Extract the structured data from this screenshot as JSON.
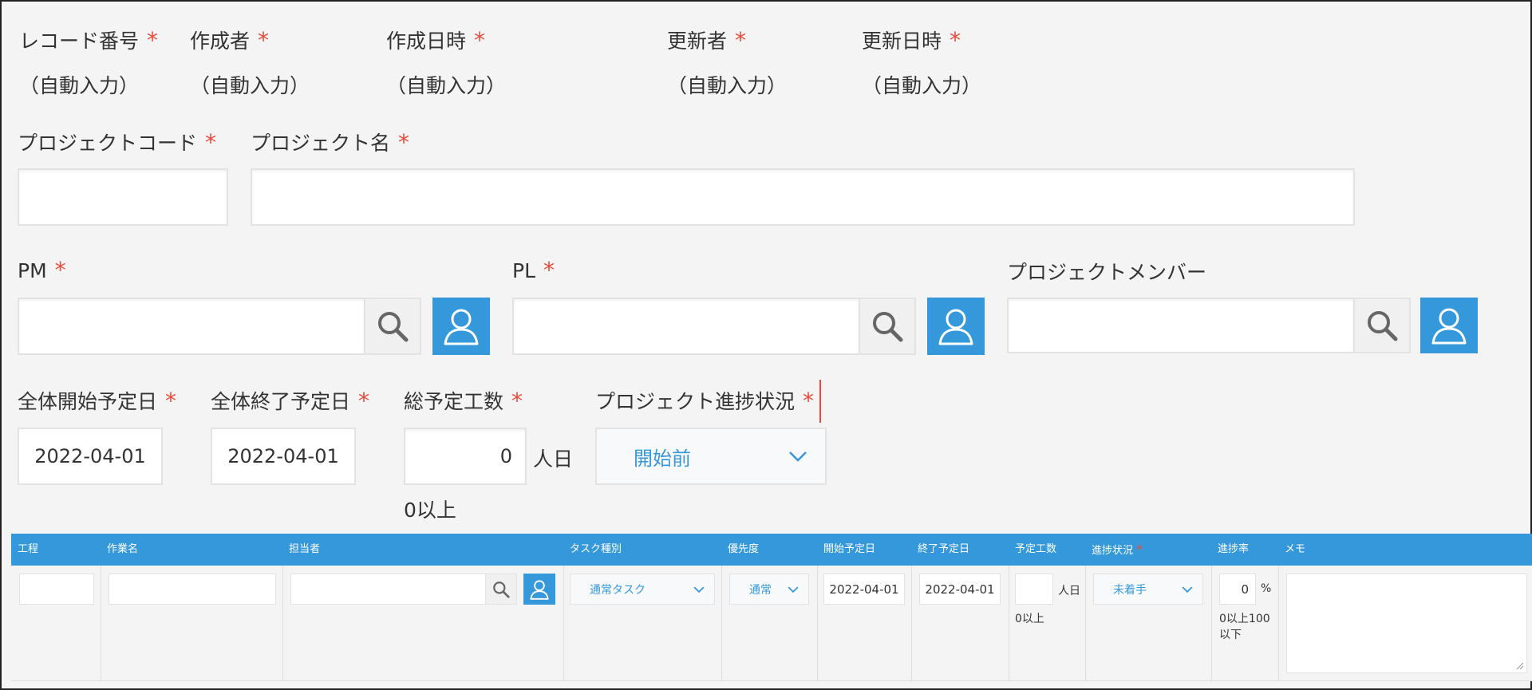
{
  "header_fields": [
    {
      "label": "レコード番号",
      "value": "（自動入力）"
    },
    {
      "label": "作成者",
      "value": "（自動入力）"
    },
    {
      "label": "作成日時",
      "value": "（自動入力）"
    },
    {
      "label": "更新者",
      "value": "（自動入力）"
    },
    {
      "label": "更新日時",
      "value": "（自動入力）"
    }
  ],
  "required_mark": "*",
  "project_code": {
    "label": "プロジェクトコード",
    "value": ""
  },
  "project_name": {
    "label": "プロジェクト名",
    "value": ""
  },
  "pm": {
    "label": "PM",
    "value": ""
  },
  "pl": {
    "label": "PL",
    "value": ""
  },
  "members": {
    "label": "プロジェクトメンバー",
    "value": ""
  },
  "start_date": {
    "label": "全体開始予定日",
    "value": "2022-04-01"
  },
  "end_date": {
    "label": "全体終了予定日",
    "value": "2022-04-01"
  },
  "total_effort": {
    "label": "総予定工数",
    "value": "0",
    "unit": "人日",
    "hint": "0以上"
  },
  "progress_status": {
    "label": "プロジェクト進捗状況",
    "value": "開始前"
  },
  "table": {
    "headers": [
      "工程",
      "作業名",
      "担当者",
      "タスク種別",
      "優先度",
      "開始予定日",
      "終了予定日",
      "予定工数",
      "進捗状況",
      "進捗率",
      "メモ"
    ],
    "row": {
      "process": "",
      "task_name": "",
      "assignee": "",
      "task_type": "通常タスク",
      "priority": "通常",
      "start": "2022-04-01",
      "end": "2022-04-01",
      "effort": "",
      "effort_unit": "人日",
      "effort_hint": "0以上",
      "status": "未着手",
      "rate": "0",
      "rate_unit": "%",
      "rate_hint_1": "0以上100",
      "rate_hint_2": "以下",
      "memo": ""
    }
  },
  "colors": {
    "accent": "#3498db",
    "required": "#e74c3c",
    "background": "#f4f4f4"
  }
}
